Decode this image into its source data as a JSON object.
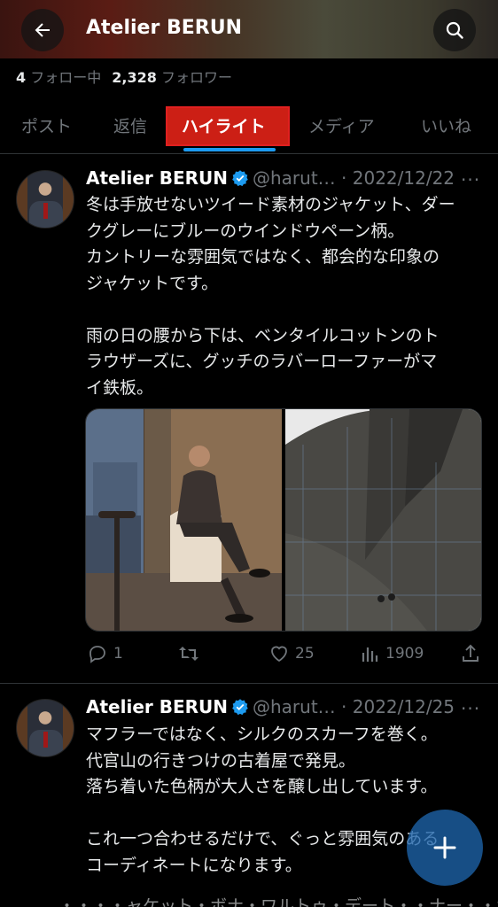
{
  "header": {
    "title": "Atelier BERUN",
    "back_icon": "back-arrow-icon",
    "search_icon": "search-icon"
  },
  "stats": {
    "following_count": "4",
    "following_label": "フォロー中",
    "followers_count": "2,328",
    "followers_label": "フォロワー"
  },
  "tabs": [
    {
      "label": "ポスト"
    },
    {
      "label": "返信"
    },
    {
      "label": "ハイライト",
      "active": true
    },
    {
      "label": "メディア"
    },
    {
      "label": "いいね"
    }
  ],
  "posts": [
    {
      "name": "Atelier BERUN",
      "handle": "@harut…",
      "dot": "·",
      "date": "2022/12/22",
      "more": "···",
      "lines": [
        "冬は手放せないツイード素材のジャケット、ダー",
        "クグレーにブルーのウインドウペーン柄。",
        "カントリーな雰囲気ではなく、都会的な印象の",
        "ジャケットです。",
        "",
        "雨の日の腰から下は、ベンタイルコットンのト",
        "ラウザーズに、グッチのラバーローファーがマ",
        "イ鉄板。"
      ],
      "replies": "1",
      "reposts": "",
      "likes": "25",
      "views": "1909"
    },
    {
      "name": "Atelier BERUN",
      "handle": "@harut…",
      "dot": "·",
      "date": "2022/12/25",
      "more": "···",
      "lines": [
        "マフラーではなく、シルクのスカーフを巻く。",
        "代官山の行きつけの古着屋で発見。",
        "落ち着いた色柄が大人さを醸し出しています。",
        "",
        "これ一つ合わせるだけで、ぐっと雰囲気のある",
        "コーディネートになります。"
      ]
    }
  ],
  "peek_text": "・・・・ャケット・ボナ・ワルトゥ・デート・・ナー・・ポ",
  "fab_icon": "plus-icon",
  "colors": {
    "background": "#000000",
    "accent": "#1d9bf0",
    "muted": "#71767b",
    "highlight": "#cc1f15"
  }
}
